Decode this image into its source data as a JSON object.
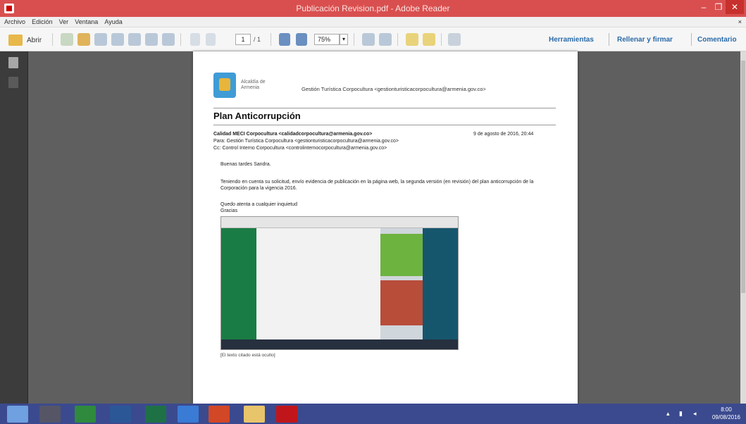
{
  "window": {
    "title": "Publicación Revision.pdf - Adobe Reader",
    "min": "–",
    "max": "❐",
    "close": "✕"
  },
  "menu": {
    "items": [
      "Archivo",
      "Edición",
      "Ver",
      "Ventana",
      "Ayuda"
    ],
    "close": "×"
  },
  "toolbar": {
    "open_label": "Abrir",
    "page_current": "1",
    "page_total": "/ 1",
    "zoom": "75%",
    "zoom_arrow": "▾",
    "tools_label": "Herramientas",
    "fill_sign_label": "Rellenar y firmar",
    "comment_label": "Comentario"
  },
  "document": {
    "logo_text": "Alcaldía de Armenia",
    "from_header": "Gestión Turística Corpocultura <gestionturisticacorpocultura@armenia.gov.co>",
    "title": "Plan Anticorrupción",
    "from_line": "Calidad MECI Corpocultura <calidadcorpocultura@armenia.gov.co>",
    "date": "9 de agosto de 2016, 20:44",
    "to_line": "Para: Gestión Turística Corpocultura <gestionturisticacorpocultura@armenia.gov.co>",
    "cc_line": "Cc: Control Interno Corpocultura <controlinternocorpocultura@armenia.gov.co>",
    "greeting": "Buenas tardes Sandra.",
    "paragraph": "Teniendo en cuenta su solicitud, envío evidencia de publicación en la página web, la segunda versión (en revisión) del plan anticorrupción de la Corporación para la vigencia 2016.",
    "closing": "Quedo atenta a cualquier inquietud",
    "signoff": "Gracias",
    "caption": "[El texto citado está oculto]"
  },
  "taskbar": {
    "time": "8:00",
    "date": "09/08/2016"
  },
  "colors": {
    "title_bar": "#d94f4f",
    "taskbar": "#3b4a8e",
    "link": "#2b6aa8"
  }
}
